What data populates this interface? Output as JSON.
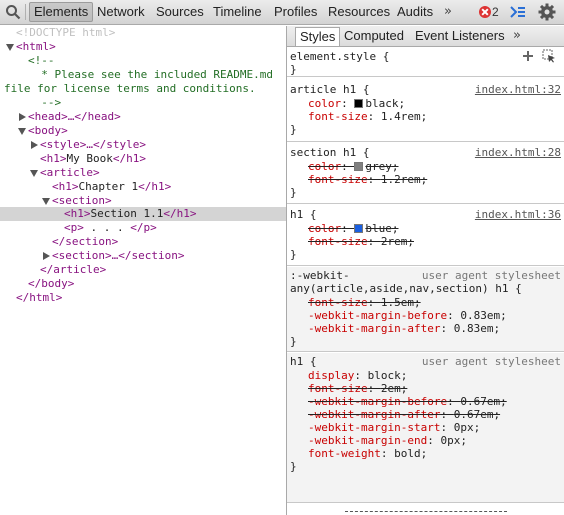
{
  "toolbar": {
    "tabs": [
      "Elements",
      "Network",
      "Sources",
      "Timeline",
      "Profiles",
      "Resources",
      "Audits"
    ],
    "more_label": "»",
    "error_count": "2",
    "icons": [
      "search-icon",
      "error-icon",
      "console-icon",
      "gear-icon"
    ]
  },
  "dom": {
    "lines": [
      {
        "text": "<!DOCTYPE html>",
        "kind": "doctype"
      },
      {
        "text": "<html>",
        "kind": "tag"
      },
      {
        "text": "<!--",
        "kind": "comment"
      },
      {
        "text": "  * Please see the included README.md",
        "kind": "comment"
      },
      {
        "text": "file for license terms and conditions.",
        "kind": "comment"
      },
      {
        "text": "  -->",
        "kind": "comment"
      },
      {
        "text": "<head>…</head>",
        "kind": "tag"
      },
      {
        "text": "<body>",
        "kind": "tag"
      },
      {
        "text": "<style>…</style>",
        "kind": "tag"
      },
      {
        "text_tag_open": "<h1>",
        "text_content": "My Book",
        "text_tag_close": "</h1>",
        "kind": "mixed"
      },
      {
        "text": "<article>",
        "kind": "tag"
      },
      {
        "text_tag_open": "<h1>",
        "text_content": "Chapter 1",
        "text_tag_close": "</h1>",
        "kind": "mixed"
      },
      {
        "text": "<section>",
        "kind": "tag"
      },
      {
        "text_tag_open": "<h1>",
        "text_content": "Section 1.1",
        "text_tag_close": "</h1>",
        "kind": "mixed"
      },
      {
        "text_tag_open": "<p>",
        "text_content": " . . . ",
        "text_tag_close": "</p>",
        "kind": "mixed"
      },
      {
        "text": "</section>",
        "kind": "tag"
      },
      {
        "text": "<section>…</section>",
        "kind": "tag"
      },
      {
        "text": "</article>",
        "kind": "tag"
      },
      {
        "text": "</body>",
        "kind": "tag"
      },
      {
        "text": "</html>",
        "kind": "tag"
      }
    ]
  },
  "sidebar": {
    "tabs": [
      "Styles",
      "Computed",
      "Event Listeners"
    ],
    "more_label": "»",
    "rules": [
      {
        "selector": "element.style {",
        "close": "}",
        "source": "",
        "props": []
      },
      {
        "selector": "article h1 {",
        "close": "}",
        "source": "index.html:32",
        "props": [
          {
            "name": "color",
            "value": "black",
            "swatch": "#000000",
            "struck": false
          },
          {
            "name": "font-size",
            "value": "1.4rem",
            "struck": false
          }
        ]
      },
      {
        "selector": "section h1 {",
        "close": "}",
        "source": "index.html:28",
        "props": [
          {
            "name": "color",
            "value": "grey",
            "swatch": "#808080",
            "struck": true
          },
          {
            "name": "font-size",
            "value": "1.2rem",
            "struck": true
          }
        ]
      },
      {
        "selector": "h1 {",
        "close": "}",
        "source": "index.html:36",
        "props": [
          {
            "name": "color",
            "value": "blue",
            "swatch": "#1a5fe0",
            "struck": true
          },
          {
            "name": "font-size",
            "value": "2rem",
            "struck": true
          }
        ]
      },
      {
        "selector": ":-webkit-",
        "selector2": "any(article,aside,nav,section) h1 {",
        "close": "}",
        "source": "user agent stylesheet",
        "props": [
          {
            "name": "font-size",
            "value": "1.5em",
            "struck": true
          },
          {
            "name": "-webkit-margin-before",
            "value": "0.83em",
            "struck": false
          },
          {
            "name": "-webkit-margin-after",
            "value": "0.83em",
            "struck": false
          }
        ]
      },
      {
        "selector": "h1 {",
        "close": "}",
        "source": "user agent stylesheet",
        "props": [
          {
            "name": "display",
            "value": "block",
            "struck": false
          },
          {
            "name": "font-size",
            "value": "2em",
            "struck": true
          },
          {
            "name": "-webkit-margin-before",
            "value": "0.67em",
            "struck": true
          },
          {
            "name": "-webkit-margin-after",
            "value": "0.67em",
            "struck": true
          },
          {
            "name": "-webkit-margin-start",
            "value": "0px",
            "struck": false
          },
          {
            "name": "-webkit-margin-end",
            "value": "0px",
            "struck": false
          },
          {
            "name": "font-weight",
            "value": "bold",
            "struck": false
          }
        ]
      }
    ]
  },
  "colors": {
    "tag": "#881280",
    "comment": "#236e25",
    "property": "#c80000",
    "selected_row": "#d4d4d4"
  }
}
